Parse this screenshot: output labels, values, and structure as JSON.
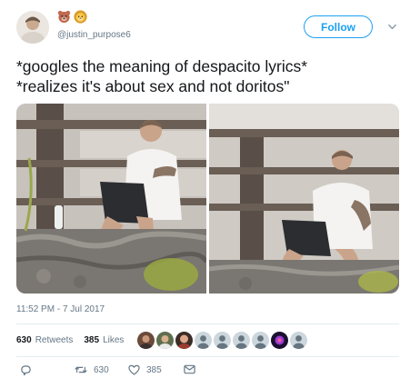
{
  "header": {
    "handle": "@justin_purpose6",
    "emojis": [
      "bear-face-emoji",
      "lion-face-emoji"
    ],
    "follow_label": "Follow"
  },
  "tweet": {
    "line1": "*googles the meaning of despacito lyrics*",
    "line2": "*realizes it's about sex and not doritos\""
  },
  "meta": {
    "timestamp": "11:52 PM - 7 Jul 2017",
    "retweets_count": "630",
    "retweets_label": "Retweets",
    "likes_count": "385",
    "likes_label": "Likes"
  },
  "actions": {
    "retweet_count": "630",
    "like_count": "385"
  },
  "icons": [
    "reply-icon",
    "retweet-icon",
    "like-icon",
    "message-icon",
    "chevron-down-icon"
  ],
  "colors": {
    "accent": "#1da1f2",
    "text": "#14171a",
    "muted": "#657786",
    "divider": "#e6ecf0"
  }
}
